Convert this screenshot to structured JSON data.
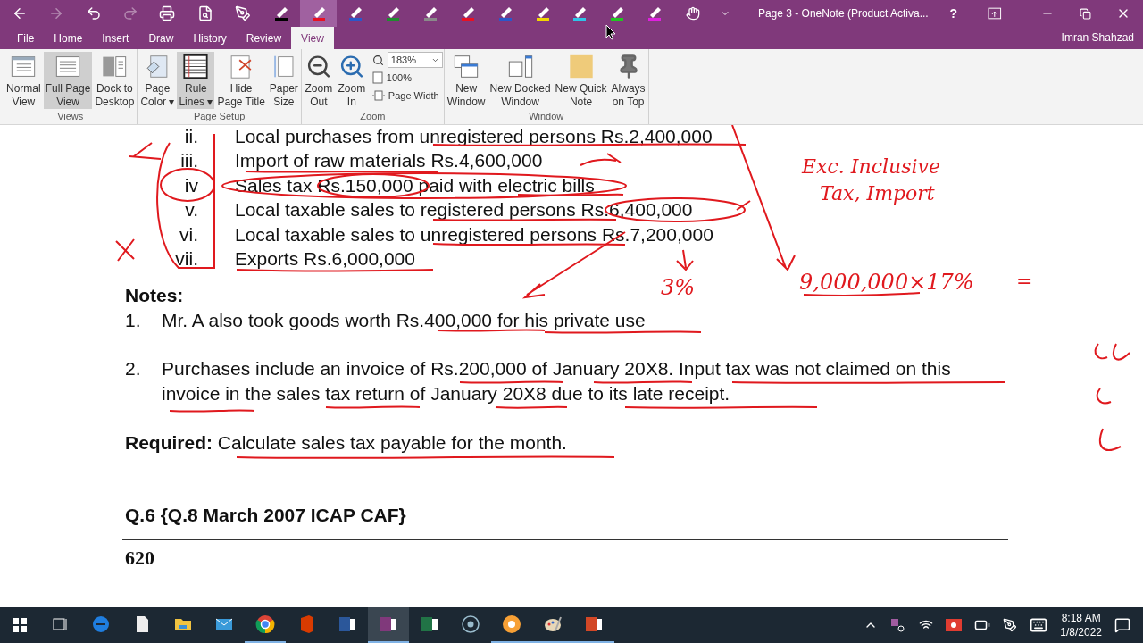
{
  "window": {
    "title": "Page 3 - OneNote (Product Activa...",
    "user": "Imran Shahzad",
    "help": "?"
  },
  "pens": [
    {
      "color": "#000000",
      "selected": false
    },
    {
      "color": "#e81123",
      "selected": true
    },
    {
      "color": "#2b57c9",
      "selected": false
    },
    {
      "color": "#1f8a2e",
      "selected": false
    },
    {
      "color": "#8a8a8a",
      "selected": false
    },
    {
      "color": "#e81123",
      "selected": false
    },
    {
      "color": "#2b57c9",
      "selected": false
    },
    {
      "color": "#f2d600",
      "selected": false
    },
    {
      "color": "#2ec4e8",
      "selected": false
    },
    {
      "color": "#21c521",
      "selected": false
    },
    {
      "color": "#e020e0",
      "selected": false
    }
  ],
  "tabs": [
    {
      "label": "File",
      "selected": false
    },
    {
      "label": "Home",
      "selected": false
    },
    {
      "label": "Insert",
      "selected": false
    },
    {
      "label": "Draw",
      "selected": false
    },
    {
      "label": "History",
      "selected": false
    },
    {
      "label": "Review",
      "selected": false
    },
    {
      "label": "View",
      "selected": true
    }
  ],
  "ribbon": [
    {
      "group": "Views",
      "items": [
        {
          "kind": "normal",
          "lines": [
            "Normal",
            "View"
          ],
          "selected": false
        },
        {
          "kind": "full",
          "lines": [
            "Full Page",
            "View"
          ],
          "selected": true
        },
        {
          "kind": "dock",
          "lines": [
            "Dock to",
            "Desktop"
          ],
          "selected": false
        }
      ]
    },
    {
      "group": "Page Setup",
      "items": [
        {
          "kind": "color",
          "lines": [
            "Page",
            "Color ▾"
          ],
          "selected": false
        },
        {
          "kind": "rule",
          "lines": [
            "Rule",
            "Lines ▾"
          ],
          "selected": true
        },
        {
          "kind": "hide",
          "lines": [
            "Hide",
            "Page Title"
          ],
          "selected": false
        },
        {
          "kind": "paper",
          "lines": [
            "Paper",
            "Size"
          ],
          "selected": false
        }
      ]
    },
    {
      "group": "Zoom",
      "items": [
        {
          "kind": "zoomout",
          "lines": [
            "Zoom",
            "Out"
          ],
          "selected": false
        },
        {
          "kind": "zoomin",
          "lines": [
            "Zoom",
            "In"
          ],
          "selected": false
        }
      ],
      "zoom_value": "183%",
      "zoom_100": "100%",
      "page_width": "Page Width"
    },
    {
      "group": "Window",
      "items": [
        {
          "kind": "newwin",
          "lines": [
            "New",
            "Window"
          ],
          "selected": false
        },
        {
          "kind": "docked",
          "lines": [
            "New Docked",
            "Window"
          ],
          "selected": false
        },
        {
          "kind": "quick",
          "lines": [
            "New Quick",
            "Note"
          ],
          "selected": false
        },
        {
          "kind": "pin",
          "lines": [
            "Always",
            "on Top"
          ],
          "selected": false
        }
      ]
    }
  ],
  "page": {
    "items": [
      {
        "numeral": "ii.",
        "text": "Local purchases from unregistered persons Rs.2,400,000"
      },
      {
        "numeral": "iii.",
        "text": "Import of raw materials Rs.4,600,000"
      },
      {
        "numeral": "iv",
        "text": "Sales tax Rs.150,000 paid with electric bills"
      },
      {
        "numeral": "v.",
        "text": "Local taxable sales to registered persons Rs.6,400,000"
      },
      {
        "numeral": "vi.",
        "text": "Local taxable sales to unregistered persons Rs.7,200,000"
      },
      {
        "numeral": "vii.",
        "text": "Exports Rs.6,000,000"
      }
    ],
    "notes_heading": "Notes:",
    "notes": [
      {
        "number": "1.",
        "text": "Mr. A also took goods worth Rs.400,000 for his private use"
      },
      {
        "number": "2.",
        "text": "Purchases include an invoice of Rs.200,000 of January 20X8. Input tax was not claimed on this invoice in the sales tax return of January 20X8 due to its late receipt."
      }
    ],
    "required": "**Required:** Calculate sales tax payable for the month.",
    "question": "Q.6 {Q.8 March 2007 ICAP CAF}",
    "page_number": "620",
    "ink_notes": [
      "Exc. Inclusive",
      "Tax, Import",
      "3%",
      "9,000,000×17%",
      "="
    ]
  },
  "taskbar": [
    {
      "kind": "tasks",
      "running": false,
      "selected": false
    },
    {
      "kind": "edge",
      "running": false,
      "selected": false
    },
    {
      "kind": "file",
      "running": false,
      "selected": false
    },
    {
      "kind": "explorer",
      "running": false,
      "selected": false
    },
    {
      "kind": "mail",
      "running": false,
      "selected": false
    },
    {
      "kind": "chrome",
      "running": true,
      "selected": false
    },
    {
      "kind": "office",
      "running": false,
      "selected": false
    },
    {
      "kind": "word",
      "running": false,
      "selected": false
    },
    {
      "kind": "onenote",
      "running": true,
      "selected": true
    },
    {
      "kind": "excel",
      "running": false,
      "selected": false
    },
    {
      "kind": "record",
      "running": false,
      "selected": false
    },
    {
      "kind": "orange",
      "running": true,
      "selected": false
    },
    {
      "kind": "paint",
      "running": true,
      "selected": false
    },
    {
      "kind": "powerpoint",
      "running": true,
      "selected": false
    }
  ],
  "clock": {
    "time": "8:18 AM",
    "date": "1/8/2022"
  }
}
